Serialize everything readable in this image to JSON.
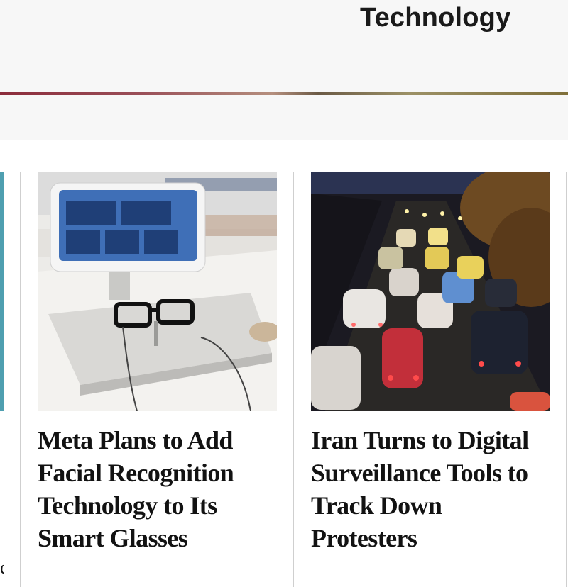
{
  "header": {
    "section_title": "Technology"
  },
  "articles": [
    {
      "title": "Meta Plans to Add Facial Recognition Technology to Its Smart Glasses",
      "image_icon": "smart-glasses-display-photo"
    },
    {
      "title": "Iran Turns to Digital Surveillance Tools to Track Down Protesters",
      "image_icon": "night-traffic-street-photo"
    }
  ],
  "colors": {
    "accent_gradient_start": "#8c2c3b",
    "accent_gradient_end": "#7f6f3a",
    "teal_sliver": "#4f9fb0",
    "text": "#121212"
  }
}
